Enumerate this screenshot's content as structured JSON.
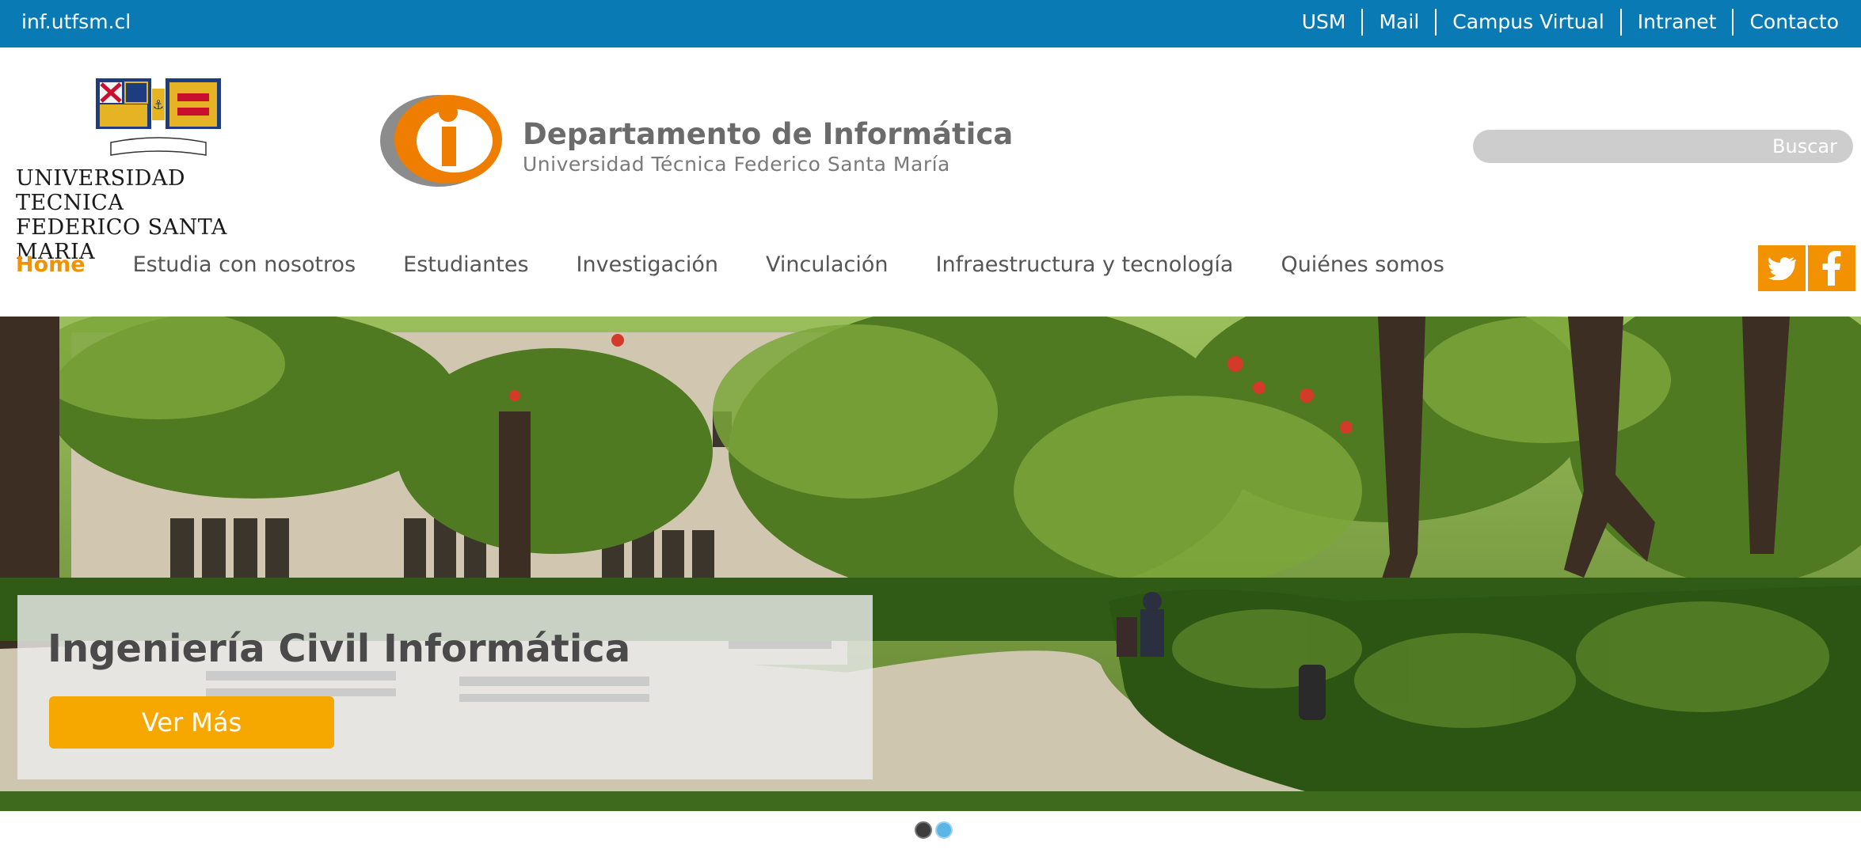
{
  "topbar": {
    "site": "inf.utfsm.cl",
    "links": [
      "USM",
      "Mail",
      "Campus Virtual",
      "Intranet",
      "Contacto"
    ]
  },
  "header": {
    "usm_logo_lines": [
      "UNIVERSIDAD TECNICA",
      "FEDERICO SANTA MARIA"
    ],
    "dept_title": "Departamento de Informática",
    "dept_subtitle": "Universidad Técnica Federico Santa María",
    "search_button": "Buscar",
    "search_placeholder": ""
  },
  "nav": {
    "items": [
      "Home",
      "Estudia con nosotros",
      "Estudiantes",
      "Investigación",
      "Vinculación",
      "Infraestructura y tecnología",
      "Quiénes somos"
    ],
    "active": "Home"
  },
  "social": {
    "twitter": "twitter-icon",
    "facebook": "facebook-icon"
  },
  "hero": {
    "title": "Ingeniería Civil Informática",
    "button": "Ver Más",
    "slides": 2,
    "current_slide": 1
  },
  "colors": {
    "topbar": "#0a7ab4",
    "accent": "#f39200",
    "button": "#f7a800"
  }
}
